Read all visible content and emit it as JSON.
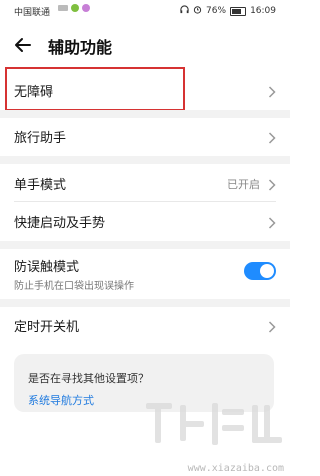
{
  "status_bar": {
    "carrier": "中国联通",
    "battery_percent_text": "76%",
    "battery_level": 0.76,
    "time": "16:09"
  },
  "header": {
    "title": "辅助功能"
  },
  "items": {
    "accessibility": {
      "label": "无障碍"
    },
    "travel_assistant": {
      "label": "旅行助手"
    },
    "one_hand": {
      "label": "单手模式",
      "value": "已开启"
    },
    "quick_launch": {
      "label": "快捷启动及手势"
    },
    "mistouch": {
      "label": "防误触模式",
      "desc": "防止手机在口袋出现误操作",
      "enabled": true
    },
    "scheduled_power": {
      "label": "定时开关机"
    }
  },
  "suggestion_card": {
    "question": "是否在寻找其他设置项？",
    "link": "系统导航方式"
  },
  "watermark": {
    "url": "www.xiazaiba.com"
  },
  "colors": {
    "accent": "#1f8cff",
    "highlight_border": "#d63333",
    "link": "#1f7adf"
  }
}
